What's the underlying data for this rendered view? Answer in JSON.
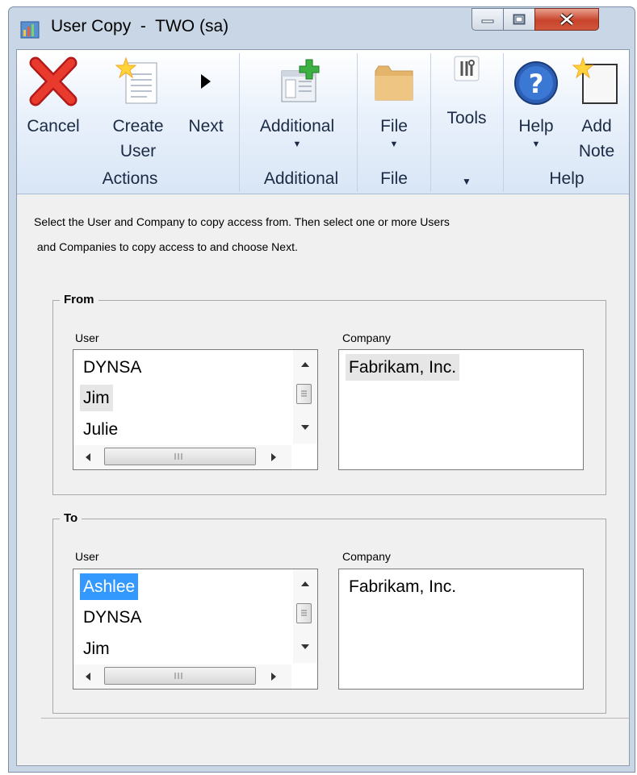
{
  "window": {
    "title": "User Copy  -  TWO (sa)"
  },
  "ribbon": {
    "actions": {
      "cancel": "Cancel",
      "create_user": [
        "Create",
        "User"
      ],
      "next": "Next",
      "group": "Actions"
    },
    "additional": {
      "button": "Additional",
      "group": "Additional"
    },
    "file": {
      "button": "File",
      "group": "File"
    },
    "tools": {
      "button": "Tools"
    },
    "help": {
      "help": "Help",
      "add_note": [
        "Add",
        "Note"
      ],
      "group": "Help"
    }
  },
  "instructions": {
    "line1": "Select the User and Company to copy access from.  Then select one or more Users",
    "line2": " and Companies to copy access to and choose Next."
  },
  "from": {
    "title": "From",
    "user_label": "User",
    "company_label": "Company",
    "users": [
      "DYNSA",
      "Jim",
      "Julie"
    ],
    "companies": [
      "Fabrikam, Inc."
    ]
  },
  "to": {
    "title": "To",
    "user_label": "User",
    "company_label": "Company",
    "users": [
      "Ashlee",
      "DYNSA",
      "Jim"
    ],
    "companies": [
      "Fabrikam, Inc."
    ]
  },
  "colors": {
    "selection": "#3399ff",
    "ribbon_text": "#1b2a44",
    "close_button": "#c8442b"
  }
}
